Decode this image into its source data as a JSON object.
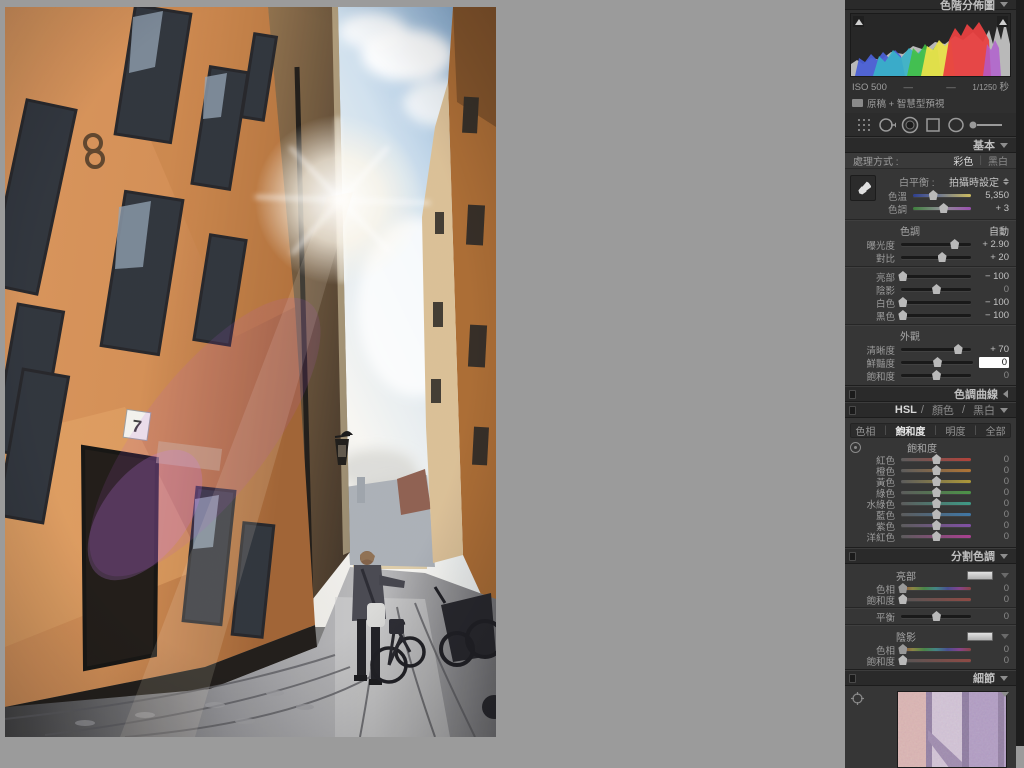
{
  "window": {
    "canvas_bg": "#9b9b9b",
    "panel_bg": "#2f2f2f"
  },
  "photo": {
    "sign": "7"
  },
  "histogram": {
    "title": "色階分佈圖",
    "exif": {
      "iso": "ISO 500",
      "dash1": "—",
      "dash2": "—",
      "shutter_frac": "1/1250",
      "shutter_unit": "秒"
    },
    "preview_label": "原稿 + 智慧型預視"
  },
  "basic": {
    "title": "基本",
    "treatment": {
      "label": "處理方式 :",
      "color": "彩色",
      "bw": "黑白"
    },
    "wb": {
      "label": "白平衡 :",
      "value": "拍攝時設定"
    },
    "tone_header": "色調",
    "auto_label": "自動",
    "presence_header": "外觀",
    "sliders": {
      "temp": {
        "label": "色溫",
        "value": "5,350",
        "pos": 34
      },
      "tint": {
        "label": "色調",
        "value": "+ 3",
        "pos": 52
      },
      "exposure": {
        "label": "曝光度",
        "value": "+ 2.90",
        "pos": 76
      },
      "contrast": {
        "label": "對比",
        "value": "+ 20",
        "pos": 58
      },
      "highlights": {
        "label": "亮部",
        "value": "− 100",
        "pos": 2
      },
      "shadows": {
        "label": "陰影",
        "value": "0",
        "pos": 50
      },
      "whites": {
        "label": "白色",
        "value": "− 100",
        "pos": 2
      },
      "blacks": {
        "label": "黑色",
        "value": "− 100",
        "pos": 2
      },
      "clarity": {
        "label": "清晰度",
        "value": "+ 70",
        "pos": 81
      },
      "vibrance": {
        "label": "鮮豔度",
        "value": "0",
        "pos": 50
      },
      "saturation": {
        "label": "飽和度",
        "value": "0",
        "pos": 50
      }
    }
  },
  "tone_curve": {
    "title": "色調曲線"
  },
  "hsl": {
    "title_hsl": "HSL",
    "sep": "/",
    "title_color": "顏色",
    "title_bw": "黑白",
    "tabs": {
      "hue": "色相",
      "sat": "飽和度",
      "lum": "明度",
      "all": "全部"
    },
    "section_title": "飽和度",
    "sliders": [
      {
        "label": "紅色",
        "value": "0",
        "color": "#b3423a"
      },
      {
        "label": "橙色",
        "value": "0",
        "color": "#b07434"
      },
      {
        "label": "黃色",
        "value": "0",
        "color": "#ad9838"
      },
      {
        "label": "綠色",
        "value": "0",
        "color": "#4c9447"
      },
      {
        "label": "水綠色",
        "value": "0",
        "color": "#3e9a86"
      },
      {
        "label": "藍色",
        "value": "0",
        "color": "#3f77a6"
      },
      {
        "label": "紫色",
        "value": "0",
        "color": "#8150a6"
      },
      {
        "label": "洋紅色",
        "value": "0",
        "color": "#aa4090"
      }
    ]
  },
  "split": {
    "title": "分割色調",
    "highlights_label": "亮部",
    "shadows_label": "陰影",
    "hl_hue": {
      "label": "色相",
      "value": "0",
      "pos": 2
    },
    "hl_sat": {
      "label": "飽和度",
      "value": "0",
      "pos": 2
    },
    "balance": {
      "label": "平衡",
      "value": "0",
      "pos": 50
    },
    "sh_hue": {
      "label": "色相",
      "value": "0",
      "pos": 2
    },
    "sh_sat": {
      "label": "飽和度",
      "value": "0",
      "pos": 2
    }
  },
  "detail": {
    "title": "細節"
  }
}
